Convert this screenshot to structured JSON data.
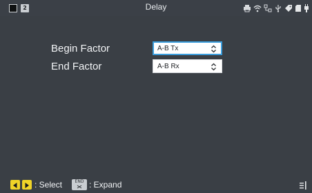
{
  "header": {
    "title": "Delay",
    "channel_number": "2"
  },
  "form": {
    "rows": [
      {
        "label": "Begin Factor",
        "value": "A-B Tx"
      },
      {
        "label": "End Factor",
        "value": "A-B Rx"
      }
    ]
  },
  "footer": {
    "select_hint": ": Select",
    "end_key_label": "END",
    "expand_hint": ": Expand"
  },
  "colors": {
    "background": "#3a3f45",
    "focus_border": "#3a9ddc",
    "nav_key": "#f0d428"
  }
}
